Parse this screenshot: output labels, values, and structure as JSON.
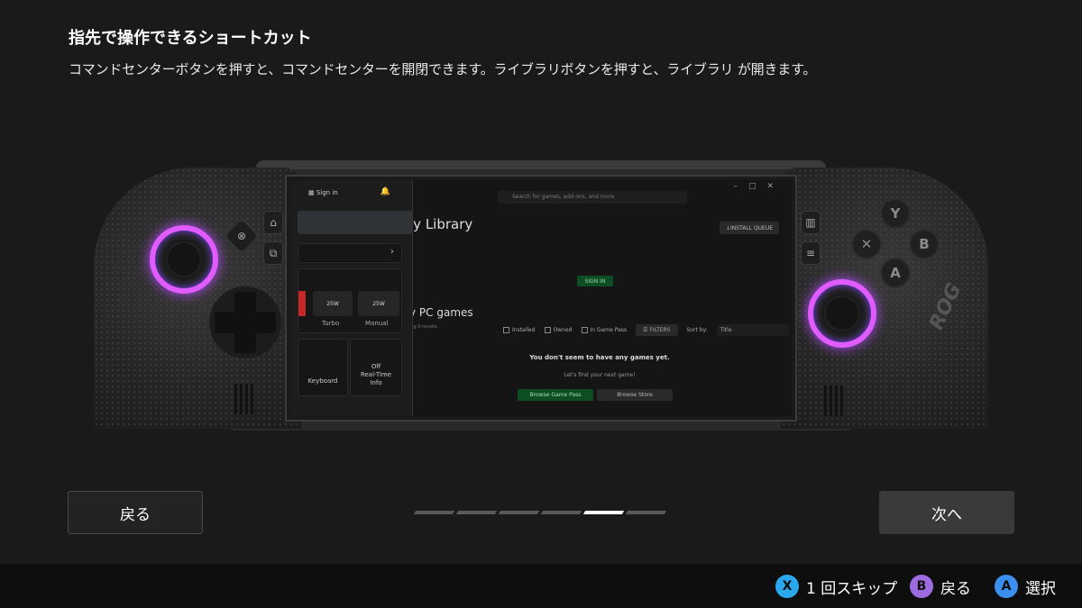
{
  "header": {
    "title": "指先で操作できるショートカット",
    "description": "コマンドセンターボタンを押すと、コマンドセンターを開閉できます。ライブラリボタンを押すと、ライブラリ が開きます。"
  },
  "device_screen": {
    "panel": {
      "sign_in": "Sign in",
      "modes": [
        "Turbo",
        "Manual"
      ],
      "mode_power": "25W",
      "tiles": [
        "Keyboard",
        "Off",
        "Real-Time",
        "Info"
      ]
    },
    "app": {
      "search_placeholder": "Search for games, add-ons, and more",
      "library_title": "ly Library",
      "install_queue": "INSTALL QUEUE",
      "sign_in_button": "SIGN IN",
      "pc_games": "y PC games",
      "results": "ing 0 results",
      "filters": [
        "Installed",
        "Owned",
        "In Game Pass"
      ],
      "filters_button": "FILTERS",
      "sort_label": "Sort by:",
      "sort_value": "Title",
      "empty_title": "You don't seem to have any games yet.",
      "empty_sub": "Let's find your next game!",
      "browse_game_pass": "Browse Game Pass",
      "browse_store": "Browse Store"
    }
  },
  "navigation": {
    "back_label": "戻る",
    "next_label": "次へ",
    "page_count": 6,
    "active_page": 5
  },
  "footer": {
    "hints": [
      {
        "key": "X",
        "label": "1 回スキップ"
      },
      {
        "key": "B",
        "label": "戻る"
      },
      {
        "key": "A",
        "label": "選択"
      }
    ]
  },
  "colors": {
    "background": "#1a1a1a",
    "stick_glow": "#e05cff",
    "hint_x": "#2aa8ee",
    "hint_b": "#9d6be0",
    "hint_a": "#3b8ff0"
  }
}
